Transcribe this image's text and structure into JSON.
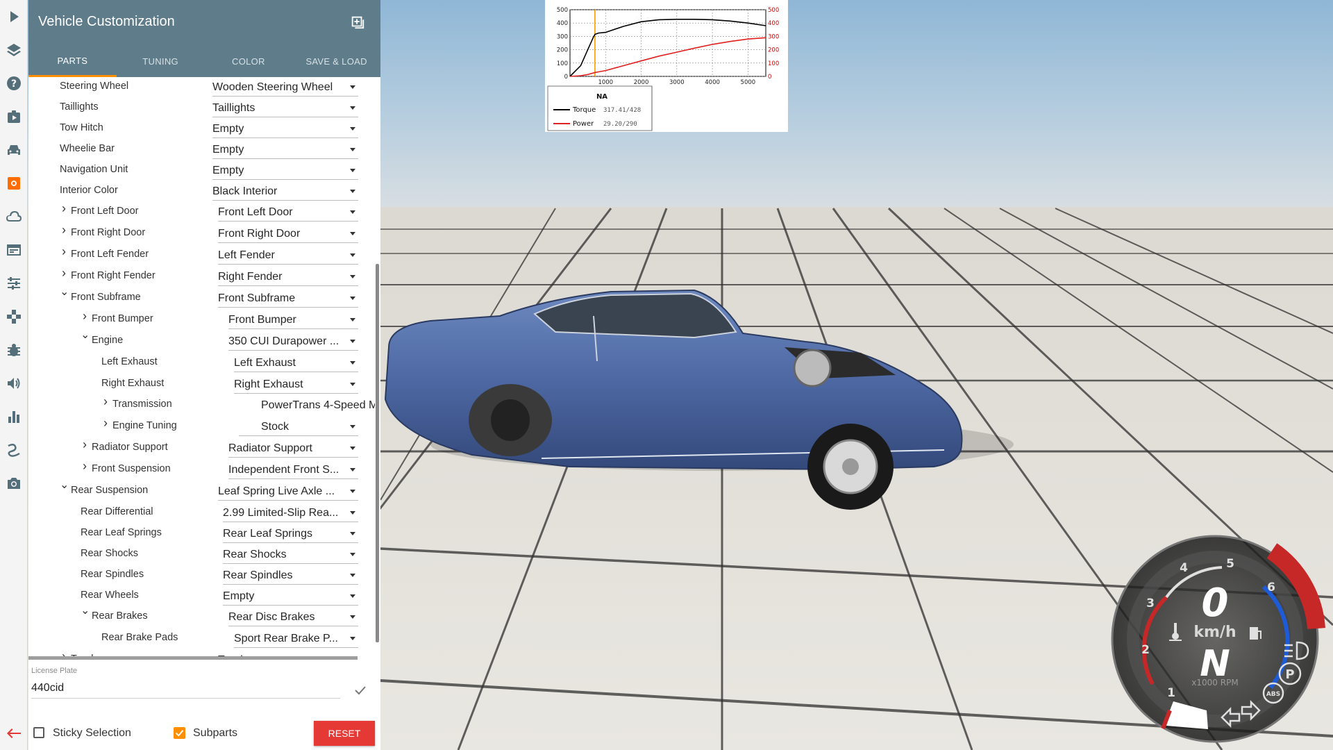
{
  "panel": {
    "title": "Vehicle Customization",
    "tabs": [
      {
        "label": "PARTS",
        "active": true
      },
      {
        "label": "TUNING",
        "active": false
      },
      {
        "label": "COLOR",
        "active": false
      },
      {
        "label": "SAVE & LOAD",
        "active": false
      }
    ],
    "parts": [
      {
        "name": "Steering Wheel",
        "value": "Wooden Steering Wheel"
      },
      {
        "name": "Taillights",
        "value": "Taillights"
      },
      {
        "name": "Tow Hitch",
        "value": "Empty"
      },
      {
        "name": "Wheelie Bar",
        "value": "Empty"
      },
      {
        "name": "Navigation Unit",
        "value": "Empty"
      },
      {
        "name": "Interior Color",
        "value": "Black Interior"
      },
      {
        "name": "Front Left Door",
        "value": "Front Left Door"
      },
      {
        "name": "Front Right Door",
        "value": "Front Right Door"
      },
      {
        "name": "Front Left Fender",
        "value": "Left Fender"
      },
      {
        "name": "Front Right Fender",
        "value": "Right Fender"
      },
      {
        "name": "Front Subframe",
        "value": "Front Subframe"
      },
      {
        "name": "Front Bumper",
        "value": "Front Bumper"
      },
      {
        "name": "Engine",
        "value": "350 CUI Durapower ..."
      },
      {
        "name": "Left Exhaust",
        "value": "Left Exhaust"
      },
      {
        "name": "Right Exhaust",
        "value": "Right Exhaust"
      },
      {
        "name": "Transmission",
        "value": "PowerTrans 4-Speed M"
      },
      {
        "name": "Engine Tuning",
        "value": "Stock"
      },
      {
        "name": "Radiator Support",
        "value": "Radiator Support"
      },
      {
        "name": "Front Suspension",
        "value": "Independent Front S..."
      },
      {
        "name": "Rear Suspension",
        "value": "Leaf Spring Live Axle ..."
      },
      {
        "name": "Rear Differential",
        "value": "2.99 Limited-Slip Rea..."
      },
      {
        "name": "Rear Leaf Springs",
        "value": "Rear Leaf Springs"
      },
      {
        "name": "Rear Shocks",
        "value": "Rear Shocks"
      },
      {
        "name": "Rear Spindles",
        "value": "Rear Spindles"
      },
      {
        "name": "Rear Wheels",
        "value": "Empty"
      },
      {
        "name": "Rear Brakes",
        "value": "Rear Disc Brakes"
      },
      {
        "name": "Rear Brake Pads",
        "value": "Sport Rear Brake P..."
      },
      {
        "name": "Trunk",
        "value": "Trunk"
      }
    ],
    "license_plate": {
      "label": "License Plate",
      "value": "440cid"
    },
    "footer": {
      "sticky_label": "Sticky Selection",
      "sticky_checked": false,
      "subparts_label": "Subparts",
      "subparts_checked": true,
      "reset_label": "RESET"
    }
  },
  "rail_icons": [
    "play-icon",
    "layers-icon",
    "help-icon",
    "scenario-icon",
    "vehicle-icon",
    "customize-icon",
    "cloud-icon",
    "browser-icon",
    "tune-icon",
    "controls-icon",
    "bug-icon",
    "volume-icon",
    "stats-icon",
    "route-icon",
    "camera-icon",
    "back-arrow-icon"
  ],
  "graph": {
    "type": "line",
    "x_ticks": [
      1000,
      2000,
      3000,
      4000,
      5000
    ],
    "y_ticks_left": [
      0,
      100,
      200,
      300,
      400,
      500
    ],
    "y_ticks_right": [
      0,
      100,
      200,
      300,
      400,
      500
    ],
    "legend_title": "NA",
    "torque_label": "Torque",
    "torque_value": "317.41/428",
    "power_label": "Power",
    "power_value": "29.20/290",
    "colors": {
      "torque": "#000000",
      "power": "#e02020",
      "marker": "#f0a000"
    }
  },
  "chart_data": {
    "type": "line",
    "title": "",
    "xlabel": "",
    "ylabel": "",
    "xlim": [
      0,
      5500
    ],
    "ylim": [
      0,
      500
    ],
    "x": [
      0,
      300,
      500,
      650,
      700,
      800,
      1000,
      1500,
      2000,
      2500,
      3000,
      3500,
      4000,
      4500,
      5000,
      5500
    ],
    "series": [
      {
        "name": "Torque",
        "values": [
          0,
          80,
          200,
          290,
          315,
          325,
          330,
          375,
          410,
          425,
          428,
          428,
          425,
          415,
          400,
          380
        ]
      },
      {
        "name": "Power",
        "values": [
          0,
          5,
          14,
          25,
          29,
          34,
          44,
          80,
          116,
          152,
          182,
          212,
          240,
          262,
          280,
          290
        ]
      }
    ],
    "marker_rpm": 700
  },
  "gauge": {
    "speed": "0",
    "speed_unit": "km/h",
    "gear": "N",
    "rpm_unit": "x1000 RPM",
    "rpm_ticks": [
      "1",
      "2",
      "3",
      "4",
      "5",
      "6"
    ],
    "abs_label": "ABS",
    "park_label": "P"
  }
}
